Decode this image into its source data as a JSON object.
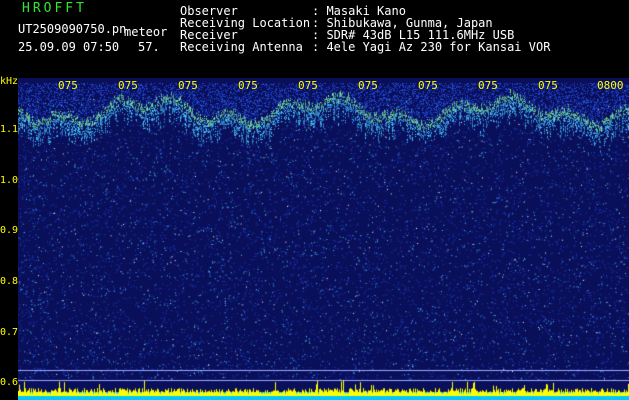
{
  "header": {
    "title": "HROFFT",
    "filename": "UT2509090750.pn",
    "suffix": "meteor",
    "datetime": "25.09.09 07:50",
    "count": "57."
  },
  "meta": [
    {
      "label": "Observer",
      "value": ": Masaki Kano"
    },
    {
      "label": "Receiving Location",
      "value": ": Shibukawa, Gunma, Japan"
    },
    {
      "label": "Receiver",
      "value": ": SDR# 43dB L15 111.6MHz USB"
    },
    {
      "label": "Receiving Antenna",
      "value": ": 4ele Yagi Az 230 for Kansai VOR"
    }
  ],
  "axis": {
    "unit": "kHz",
    "y_ticks": [
      "1.1",
      "1.0",
      "0.9",
      "0.8",
      "0.7",
      "0.6"
    ],
    "x_ticks": [
      "075",
      "075",
      "075",
      "075",
      "075",
      "075",
      "075",
      "075",
      "075",
      "075",
      "0800"
    ]
  },
  "colors": {
    "title": "#2ee82e",
    "text": "#ffffff",
    "axis_text": "#ffff00",
    "background": "#0a0f5a",
    "noise_blue": "#1e46d2",
    "noise_cyan": "#46c8ff",
    "echo": "#78e6a0",
    "bar_cyan": "#00c8ff",
    "bar_yellow": "#ffff00"
  }
}
